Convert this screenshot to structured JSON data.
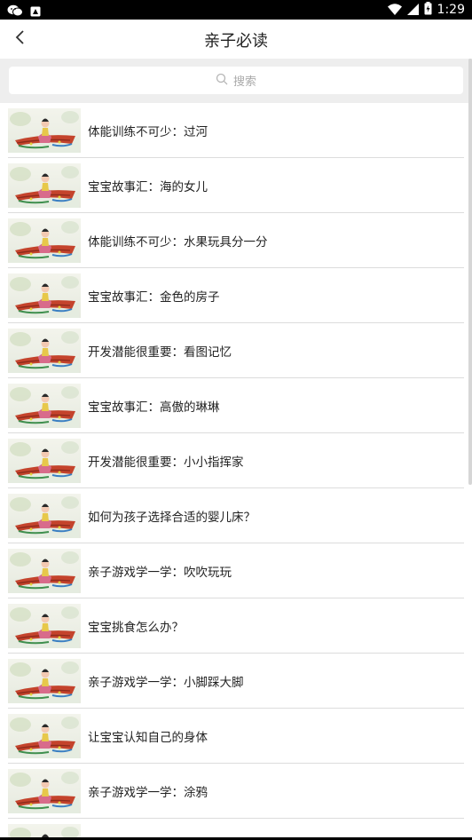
{
  "statusbar": {
    "time": "1:29",
    "icons": [
      "wechat-icon",
      "notification-icon",
      "wifi-icon",
      "signal-icon",
      "battery-icon"
    ]
  },
  "header": {
    "title": "亲子必读",
    "back_icon": "chevron-left-icon"
  },
  "search": {
    "placeholder": "搜索",
    "icon": "search-icon"
  },
  "articles": [
    {
      "title": "体能训练不可少：过河"
    },
    {
      "title": "宝宝故事汇：海的女儿"
    },
    {
      "title": "体能训练不可少：水果玩具分一分"
    },
    {
      "title": "宝宝故事汇：金色的房子"
    },
    {
      "title": "开发潜能很重要：看图记忆"
    },
    {
      "title": "宝宝故事汇：高傲的琳琳"
    },
    {
      "title": "开发潜能很重要：小小指挥家"
    },
    {
      "title": "如何为孩子选择合适的婴儿床？"
    },
    {
      "title": "亲子游戏学一学：吹吹玩玩"
    },
    {
      "title": "宝宝挑食怎么办？"
    },
    {
      "title": "亲子游戏学一学：小脚踩大脚"
    },
    {
      "title": "让宝宝认知自己的身体"
    },
    {
      "title": "亲子游戏学一学：涂鸦"
    },
    {
      "title": ""
    }
  ],
  "colors": {
    "statusbar": "#000000",
    "background": "#ffffff",
    "search_strip": "#eeeeee",
    "divider": "#dcdcdc",
    "placeholder": "#aaaaaa"
  }
}
